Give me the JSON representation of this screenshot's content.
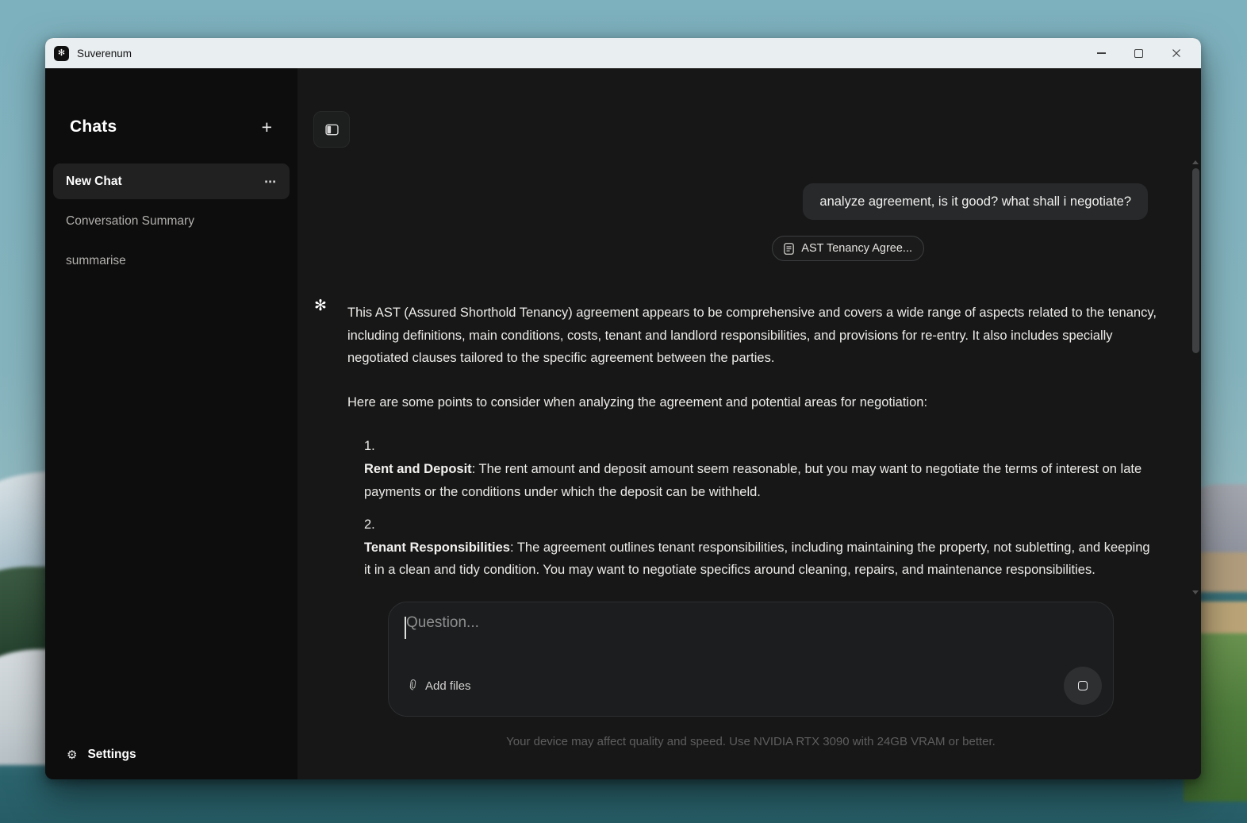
{
  "window": {
    "title": "Suverenum"
  },
  "icons": {
    "logo": "✻",
    "gear": "⚙",
    "plus": "+",
    "menu": "⋯"
  },
  "sidebar": {
    "header": {
      "title": "Chats"
    },
    "items": [
      {
        "label": "New Chat"
      },
      {
        "label": "Conversation Summary"
      },
      {
        "label": "summarise"
      }
    ],
    "settings_label": "Settings"
  },
  "chat": {
    "user_message": "analyze agreement, is it good? what shall i negotiate?",
    "attachment_name": "AST Tenancy Agree...",
    "assistant": {
      "paragraphs": [
        "This AST (Assured Shorthold Tenancy) agreement appears to be comprehensive and covers a wide range of aspects related to the tenancy, including definitions, main conditions, costs, tenant and landlord responsibilities, and provisions for re-entry. It also includes specially negotiated clauses tailored to the specific agreement between the parties.",
        "Here are some points to consider when analyzing the agreement and potential areas for negotiation:"
      ],
      "list": [
        {
          "marker": "1.",
          "title": "Rent and Deposit",
          "text": ": The rent amount and deposit amount seem reasonable, but you may want to negotiate the terms of interest on late payments or the conditions under which the deposit can be withheld."
        },
        {
          "marker": "2.",
          "title": "Tenant Responsibilities",
          "text": ": The agreement outlines tenant responsibilities, including maintaining the property, not subletting, and keeping it in a clean and tidy condition. You may want to negotiate specifics around cleaning, repairs, and maintenance responsibilities."
        }
      ]
    }
  },
  "composer": {
    "placeholder": "Question...",
    "add_files_label": "Add files",
    "footer_note": "Your device may affect quality and speed. Use NVIDIA RTX 3090 with 24GB VRAM or better."
  },
  "theme": {
    "titlebar_bg": "#e9eef1",
    "sidebar_bg": "#0d0d0d",
    "main_bg": "#171717",
    "bubble_bg": "#27292b",
    "wallpaper_teal": "#85b3bd",
    "water_teal": "#2b636d"
  }
}
